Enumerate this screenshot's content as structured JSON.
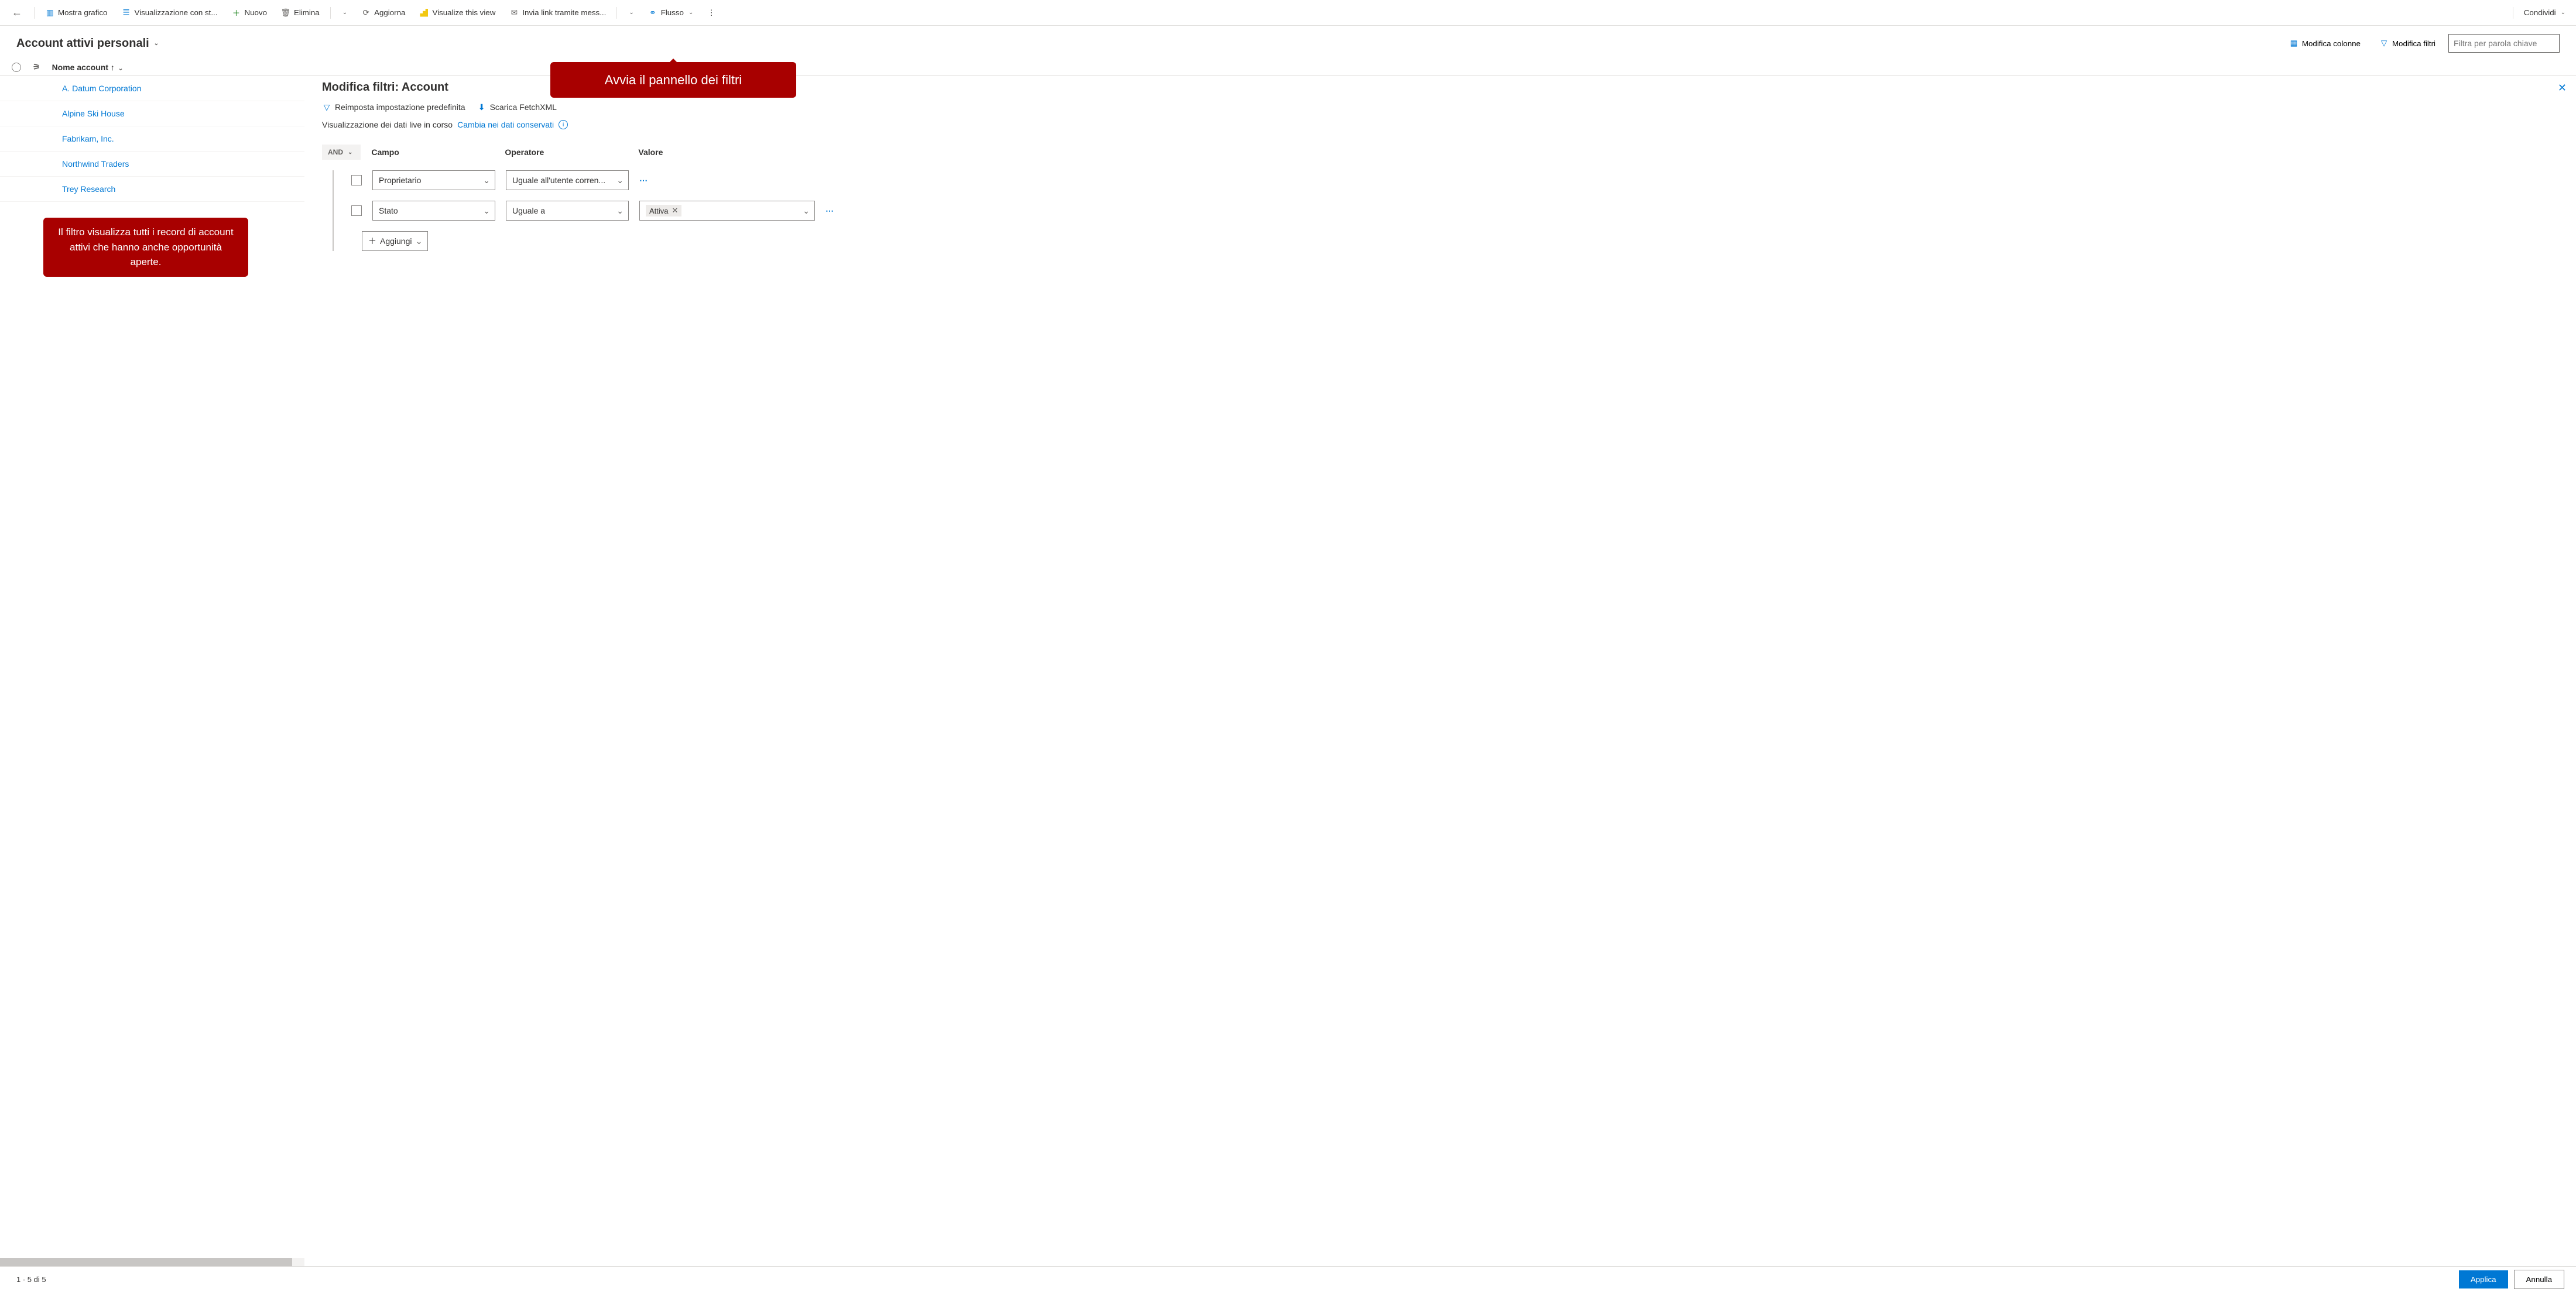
{
  "commandBar": {
    "back": "←",
    "showChart": "Mostra grafico",
    "visualization": "Visualizzazione con st...",
    "new": "Nuovo",
    "delete": "Elimina",
    "refresh": "Aggiorna",
    "visualize": "Visualize this view",
    "emailLink": "Invia link tramite mess...",
    "flow": "Flusso",
    "share": "Condividi"
  },
  "header": {
    "viewName": "Account attivi personali",
    "editColumns": "Modifica colonne",
    "editFilters": "Modifica filtri",
    "filterPlaceholder": "Filtra per parola chiave"
  },
  "gridHeader": {
    "colName": "Nome account",
    "sortIndicator": "↑"
  },
  "rows": [
    "A. Datum Corporation",
    "Alpine Ski House",
    "Fabrikam, Inc.",
    "Northwind Traders",
    "Trey Research"
  ],
  "panel": {
    "title": "Modifica filtri: Account",
    "reset": "Reimposta impostazione predefinita",
    "download": "Scarica FetchXML",
    "liveData": "Visualizzazione dei dati live in corso",
    "switchData": "Cambia nei dati conservati",
    "groupOp": "AND",
    "colCampo": "Campo",
    "colOperatore": "Operatore",
    "colValore": "Valore",
    "row1Campo": "Proprietario",
    "row1Op": "Uguale all'utente corren...",
    "row2Campo": "Stato",
    "row2Op": "Uguale a",
    "row2Val": "Attiva",
    "addLabel": "Aggiungi",
    "apply": "Applica",
    "cancel": "Annulla"
  },
  "callouts": {
    "top": "Avvia il pannello dei filtri",
    "left": "Il filtro visualizza tutti i record di account attivi che hanno anche opportunità aperte."
  },
  "footer": {
    "status": "1 - 5 di 5"
  }
}
